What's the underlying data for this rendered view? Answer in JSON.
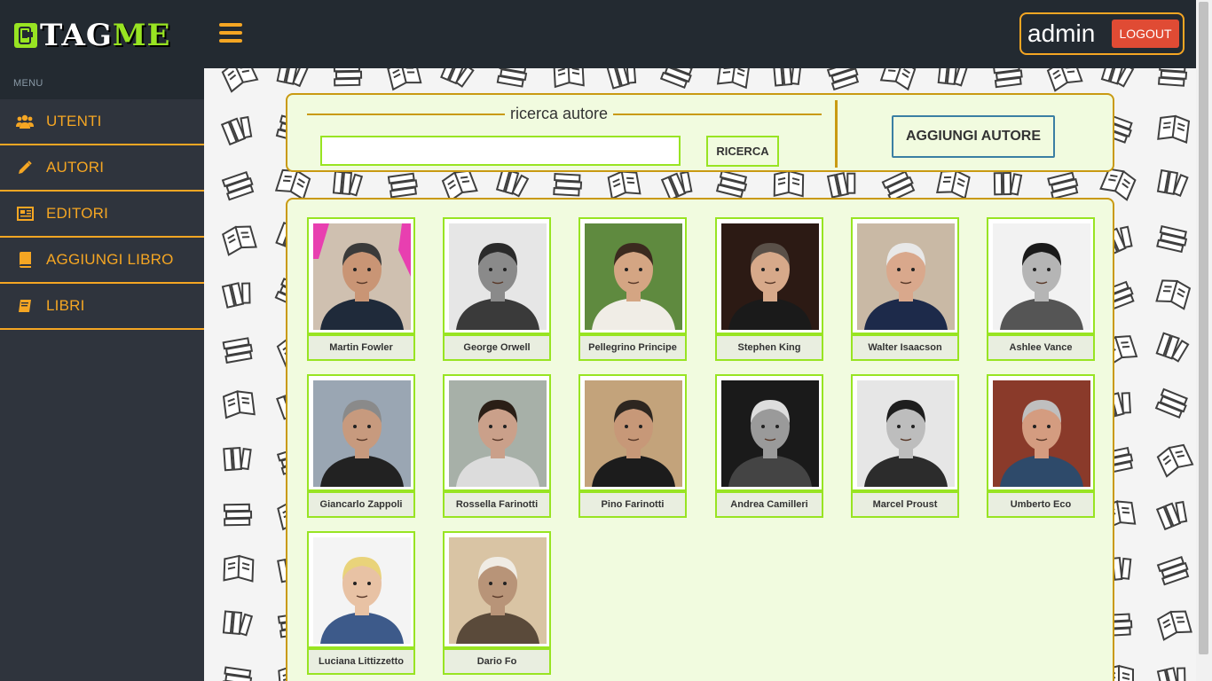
{
  "header": {
    "logo": {
      "part1": "TAG",
      "part2": "ME",
      "icon": "tag-phone-icon"
    },
    "menu_icon": "hamburger-icon",
    "username": "admin",
    "logout_label": "LOGOUT"
  },
  "sidebar": {
    "menu_label": "MENU",
    "items": [
      {
        "label": "UTENTI",
        "icon": "users-icon"
      },
      {
        "label": "AUTORI",
        "icon": "pencil-icon"
      },
      {
        "label": "EDITORI",
        "icon": "newspaper-icon"
      },
      {
        "label": "AGGIUNGI LIBRO",
        "icon": "book-icon"
      },
      {
        "label": "LIBRI",
        "icon": "books-icon"
      }
    ]
  },
  "search": {
    "legend": "ricerca autore",
    "input_value": "",
    "button_label": "RICERCA",
    "add_author_label": "AGGIUNGI AUTORE"
  },
  "authors": [
    {
      "name": "Martin Fowler"
    },
    {
      "name": "George Orwell"
    },
    {
      "name": "Pellegrino Principe"
    },
    {
      "name": "Stephen King"
    },
    {
      "name": "Walter Isaacson"
    },
    {
      "name": "Ashlee Vance"
    },
    {
      "name": "Giancarlo Zappoli"
    },
    {
      "name": "Rossella Farinotti"
    },
    {
      "name": "Pino Farinotti"
    },
    {
      "name": "Andrea Camilleri"
    },
    {
      "name": "Marcel Proust"
    },
    {
      "name": "Umberto Eco"
    },
    {
      "name": "Luciana Littizzetto"
    },
    {
      "name": "Dario Fo"
    }
  ],
  "colors": {
    "accent": "#f5a623",
    "green": "#98e422",
    "panel_bg": "#f1fbdf",
    "panel_border": "#c99a12",
    "header_bg": "#232a31",
    "sidebar_bg": "#2f343d",
    "logout_bg": "#e04b34"
  }
}
